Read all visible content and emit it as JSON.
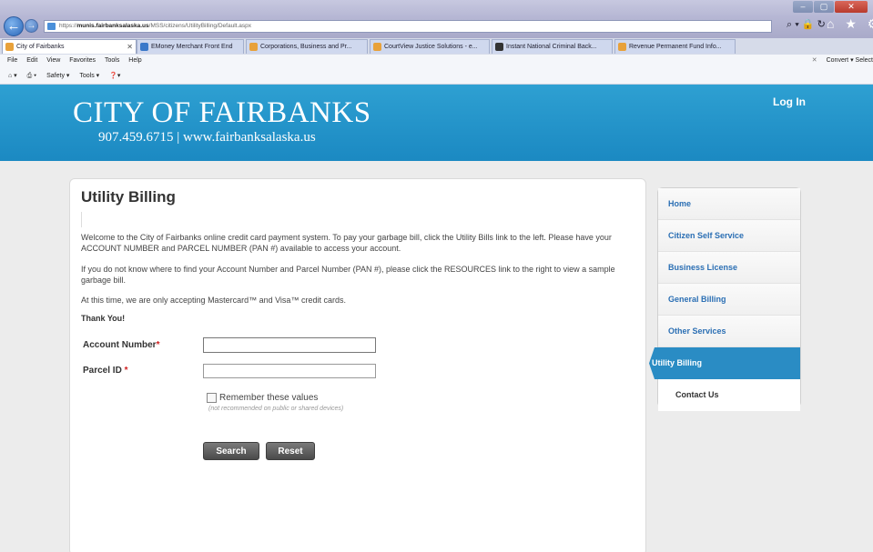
{
  "browser": {
    "url_prefix": "https://",
    "url_domain": "munis.fairbanksalaska.us",
    "url_path": "/MSS/citizens/UtilityBilling/Default.aspx",
    "addr_tools": "⌕ ▾ 🔒 ↻",
    "home_icons": "⌂ ★ ⚙",
    "tabs": [
      {
        "label": "City of Fairbanks"
      },
      {
        "label": "EMoney Merchant Front End"
      },
      {
        "label": "Corporations, Business and Pr..."
      },
      {
        "label": "CourtView Justice Solutions - e..."
      },
      {
        "label": "Instant National Criminal Back..."
      },
      {
        "label": "Revenue Permanent Fund Info..."
      }
    ],
    "menu": [
      "File",
      "Edit",
      "View",
      "Favorites",
      "Tools",
      "Help"
    ],
    "command_bar": [
      "Safety ▾",
      "Tools ▾"
    ],
    "convert": "Convert",
    "select": "Select"
  },
  "header": {
    "title": "CITY OF FAIRBANKS",
    "subtitle": "907.459.6715 | www.fairbanksalaska.us",
    "login": "Log In"
  },
  "main": {
    "heading": "Utility Billing",
    "para1": "Welcome to the City of Fairbanks online credit card payment system. To pay your garbage bill, click the Utility Bills link to the left. Please have your ACCOUNT NUMBER and PARCEL NUMBER (PAN #) available to access your account.",
    "para2": "If you do not know where to find your Account Number and Parcel Number (PAN #), please click the RESOURCES link to the right to view a sample garbage bill.",
    "para3": "At this time, we are only accepting Mastercard™ and Visa™ credit cards.",
    "thanks": "Thank You!",
    "account_label": "Account Number",
    "parcel_label": "Parcel ID",
    "required_mark": "*",
    "account_value": "",
    "parcel_value": "",
    "remember_label": "Remember these values",
    "remember_note": "(not recommended on public or shared devices)",
    "remember_checked": false,
    "search_label": "Search",
    "reset_label": "Reset"
  },
  "nav": {
    "items": [
      {
        "label": "Home",
        "active": false
      },
      {
        "label": "Citizen Self Service",
        "active": false
      },
      {
        "label": "Business License",
        "active": false
      },
      {
        "label": "General Billing",
        "active": false
      },
      {
        "label": "Other Services",
        "active": false
      },
      {
        "label": "Utility Billing",
        "active": true
      },
      {
        "label": "Contact Us",
        "active": false,
        "sub": true
      }
    ]
  },
  "colors": {
    "header_blue": "#1b89c2",
    "nav_link": "#2b6fb4",
    "required_red": "#d02020"
  }
}
